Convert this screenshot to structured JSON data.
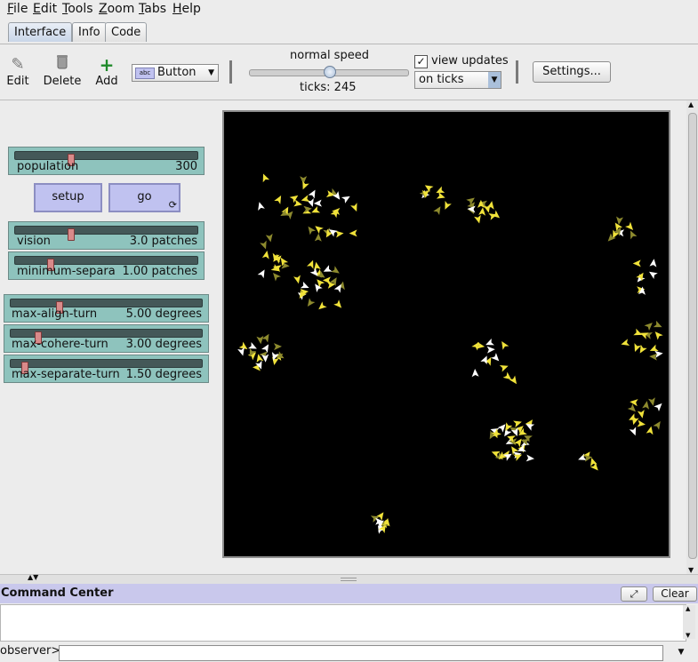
{
  "menu": [
    "File",
    "Edit",
    "Tools",
    "Zoom",
    "Tabs",
    "Help"
  ],
  "menu_mnemonic": [
    "F",
    "E",
    "T",
    "Z",
    "T",
    "H"
  ],
  "tabs": [
    "Interface",
    "Info",
    "Code"
  ],
  "toolbar": {
    "edit": "Edit",
    "delete": "Delete",
    "add": "Add",
    "widget_type": "Button",
    "speed_label": "normal speed",
    "speed_fraction": 0.5,
    "ticks": "ticks: 245",
    "view_updates": "view updates",
    "view_updates_checked": true,
    "update_mode": "on ticks",
    "settings": "Settings..."
  },
  "sliders": [
    {
      "label": "population",
      "value": "300",
      "fraction": 0.3
    },
    {
      "label": "vision",
      "value": "3.0 patches",
      "fraction": 0.3
    },
    {
      "label": "minimum-separat...",
      "value": "1.00 patches",
      "fraction": 0.19
    },
    {
      "label": "max-align-turn",
      "value": "5.00 degrees",
      "fraction": 0.25
    },
    {
      "label": "max-cohere-turn",
      "value": "3.00 degrees",
      "fraction": 0.14
    },
    {
      "label": "max-separate-turn",
      "value": "1.50 degrees",
      "fraction": 0.07
    }
  ],
  "buttons": {
    "setup": "setup",
    "go": "go"
  },
  "command_center": {
    "title": "Command Center",
    "clear": "Clear",
    "prompt": "observer>"
  },
  "colors": {
    "slider": "#8ec3bd",
    "button": "#c0c2f0",
    "view": "#000000",
    "agent": "#f0e23a",
    "agent_dim": "#8d8a2e",
    "cc_header": "#c9c8ec"
  }
}
